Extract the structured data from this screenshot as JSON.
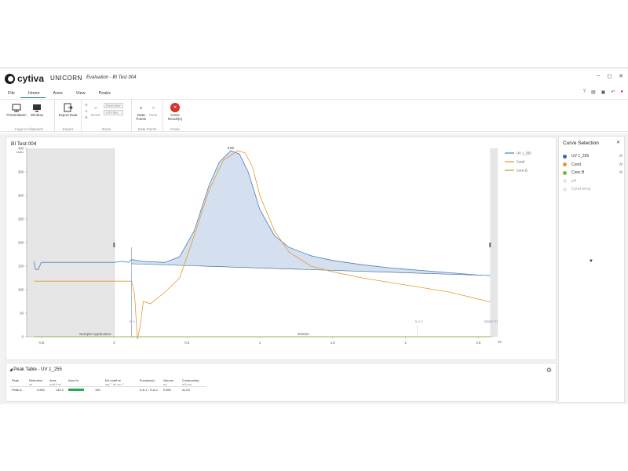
{
  "app": {
    "brand": "cytiva",
    "product": "UNICORN",
    "window_title": "Evaluation - BI Test 004",
    "win_buttons": [
      "–",
      "◻",
      "✕"
    ]
  },
  "menu": {
    "items": [
      "File",
      "Home",
      "Axes",
      "View",
      "Peaks"
    ],
    "active": "Home"
  },
  "ribbon": {
    "groups": [
      {
        "label": "Copy to Clipboard",
        "buttons": [
          "Presentation",
          "Window"
        ]
      },
      {
        "label": "Export",
        "buttons": [
          "Export Data"
        ]
      },
      {
        "label": "Zoom",
        "buttons": [
          "Reset"
        ],
        "pills": [
          "Overview",
          "All Files"
        ]
      },
      {
        "label": "Data Points",
        "buttons": [
          "Data Points",
          "Clear"
        ]
      },
      {
        "label": "Close",
        "buttons": [
          "Close Result(s)"
        ]
      }
    ]
  },
  "chart": {
    "title": "BI Test 004",
    "y_unit": "mAU",
    "x_unit": "ml",
    "legend": [
      {
        "name": "UV 1_255",
        "color": "#4a7fbf"
      },
      {
        "name": "Cond",
        "color": "#e59a2c"
      },
      {
        "name": "Conc B",
        "color": "#7bb53a"
      }
    ],
    "peak_label": "0.80",
    "fraction_labels": [
      "S.A.1",
      "S.A.2"
    ],
    "waste_label": "Waste F1",
    "phase_labels": [
      "Sample Application",
      "Elution"
    ]
  },
  "chart_data": {
    "type": "line",
    "xlim": [
      -0.6,
      2.6
    ],
    "ylim": [
      0,
      400
    ],
    "x_ticks": [
      "-0.5",
      "0",
      "0.5",
      "1",
      "1.5",
      "2",
      "2.5"
    ],
    "y_ticks": [
      "0",
      "50",
      "100",
      "150",
      "200",
      "250",
      "300",
      "350",
      "400"
    ],
    "series": [
      {
        "name": "UV 1_255",
        "x": [
          -0.55,
          -0.54,
          -0.52,
          -0.5,
          0,
          0.05,
          0.1,
          0.12,
          0.2,
          0.35,
          0.45,
          0.55,
          0.65,
          0.72,
          0.8,
          0.86,
          0.92,
          1.0,
          1.1,
          1.2,
          1.35,
          1.5,
          1.7,
          1.9,
          2.1,
          2.3,
          2.5,
          2.58
        ],
        "y": [
          160,
          143,
          143,
          158,
          158,
          160,
          158,
          164,
          160,
          158,
          170,
          225,
          320,
          370,
          395,
          388,
          350,
          270,
          215,
          190,
          172,
          162,
          153,
          146,
          141,
          136,
          131,
          130
        ]
      },
      {
        "name": "Cond",
        "x": [
          -0.55,
          -0.5,
          0,
          0.12,
          0.14,
          0.16,
          0.18,
          0.2,
          0.25,
          0.35,
          0.45,
          0.55,
          0.65,
          0.75,
          0.85,
          0.9,
          0.95,
          1.0,
          1.1,
          1.2,
          1.35,
          1.5,
          1.7,
          1.9,
          2.1,
          2.3,
          2.58
        ],
        "y": [
          118,
          118,
          118,
          118,
          90,
          -5,
          25,
          75,
          70,
          95,
          125,
          215,
          310,
          375,
          395,
          390,
          360,
          300,
          225,
          180,
          150,
          138,
          125,
          115,
          105,
          95,
          74
        ]
      },
      {
        "name": "Conc B",
        "x": [
          -0.55,
          0,
          0.2,
          2.58
        ],
        "y": [
          0,
          0,
          0,
          0
        ]
      }
    ],
    "peak_baseline": {
      "x": [
        0.12,
        2.58
      ],
      "y": [
        155,
        130
      ]
    },
    "peak_annotation": {
      "x": 0.8,
      "y": 395,
      "text": "0.80"
    },
    "markers": [
      {
        "x": 0.12,
        "label": "S.A.1"
      },
      {
        "x": 2.08,
        "label": "S.A.2"
      }
    ],
    "injection_region": [
      -0.6,
      0.0
    ],
    "end_region": [
      2.58,
      2.6
    ]
  },
  "peak_table": {
    "title": "Peak Table - UV 1_255",
    "headers": [
      {
        "name": "Peak",
        "unit": ""
      },
      {
        "name": "Retention",
        "unit": "ml"
      },
      {
        "name": "Area",
        "unit": "mAU*ml"
      },
      {
        "name": "Area %",
        "unit": ""
      },
      {
        "name": "Ext coeff  at",
        "unit": "mg⁻¹ ml cm⁻¹"
      },
      {
        "name": "Fraction(s)",
        "unit": ""
      },
      {
        "name": "Volume",
        "unit": "ml"
      },
      {
        "name": "Conductivity",
        "unit": "mS/cm"
      }
    ],
    "rows": [
      {
        "peak": "Peak A",
        "retention": "0.802",
        "area": "143.2",
        "area_pct": "100",
        "area_pct_value": 1.0,
        "ext": "",
        "fractions": "S.A.1 - S.A.2",
        "volume": "2.469",
        "conductivity": "41.03"
      }
    ]
  },
  "curve_selection": {
    "title": "Curve Selection",
    "items": [
      {
        "label": "UV 1_255",
        "color": "#2d6db5",
        "active": true,
        "fx": "fx"
      },
      {
        "label": "Cond",
        "color": "#e59a2c",
        "active": true,
        "fx": "fx"
      },
      {
        "label": "Conc B",
        "color": "#7bb53a",
        "active": true,
        "fx": "fx"
      },
      {
        "label": "pH",
        "color": "#e5e5e5",
        "active": false,
        "fx": ""
      },
      {
        "label": "Cond temp",
        "color": "#e5e5e5",
        "active": false,
        "fx": ""
      }
    ]
  }
}
